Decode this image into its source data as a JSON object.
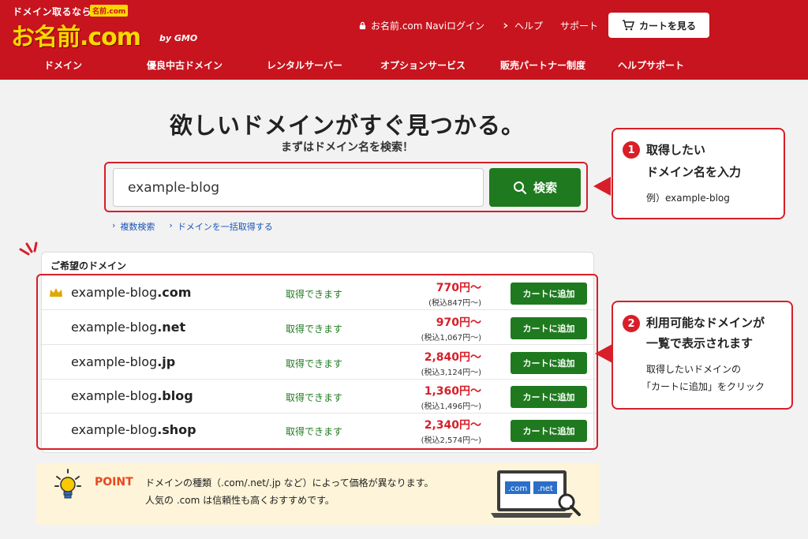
{
  "header": {
    "tagline": "ドメイン取るなら",
    "badge": "名前.com",
    "logo_text": "お名前.com",
    "gmo": "by GMO",
    "links": [
      "お名前.com Naviログイン",
      "ヘルプ",
      "サポート"
    ],
    "cart_label": "カートを見る",
    "nav": [
      "ドメイン",
      "優良中古ドメイン",
      "レンタルサーバー",
      "オプションサービス",
      "販売パートナー制度",
      "ヘルプサポート"
    ]
  },
  "hero": {
    "title": "欲しいドメインがすぐ見つかる。",
    "subtitle": "まずはドメイン名を検索！"
  },
  "search": {
    "value": "example-blog",
    "button_label": "検索"
  },
  "sublinks": [
    "複数検索",
    "ドメインを一括取得する"
  ],
  "callout1": {
    "number": "1",
    "title_line1": "取得したい",
    "title_line2": "ドメイン名を入力",
    "example": "例）example-blog"
  },
  "callout2": {
    "number": "2",
    "title_line1": "利用可能なドメインが",
    "title_line2": "一覧で表示されます",
    "text_line1": "取得したいドメインの",
    "text_line2": "「カートに追加」をクリック"
  },
  "results": {
    "label": "ご希望のドメイン",
    "rows": [
      {
        "base": "example-blog",
        "tld": ".com",
        "status": "取得できます",
        "price": "770円～",
        "tax": "(税込847円～)",
        "button": "カートに追加"
      },
      {
        "base": "example-blog",
        "tld": ".net",
        "status": "取得できます",
        "price": "970円～",
        "tax": "(税込1,067円～)",
        "button": "カートに追加"
      },
      {
        "base": "example-blog",
        "tld": ".jp",
        "status": "取得できます",
        "price": "2,840円～",
        "tax": "(税込3,124円～)",
        "button": "カートに追加"
      },
      {
        "base": "example-blog",
        "tld": ".blog",
        "status": "取得できます",
        "price": "1,360円～",
        "tax": "(税込1,496円～)",
        "button": "カートに追加"
      },
      {
        "base": "example-blog",
        "tld": ".shop",
        "status": "取得できます",
        "price": "2,340円～",
        "tax": "(税込2,574円～)",
        "button": "カートに追加"
      }
    ]
  },
  "point": {
    "label": "POINT",
    "line1": "ドメインの種類（.com/.net/.jp など）によって価格が異なります。",
    "line2": "人気の .com は信頼性も高くおすすめです。",
    "laptop_tag1": ".com",
    "laptop_tag2": ".net"
  },
  "colors": {
    "brand_red": "#c8141e",
    "accent_green": "#1f7a1f",
    "logo_yellow": "#f8d800"
  }
}
